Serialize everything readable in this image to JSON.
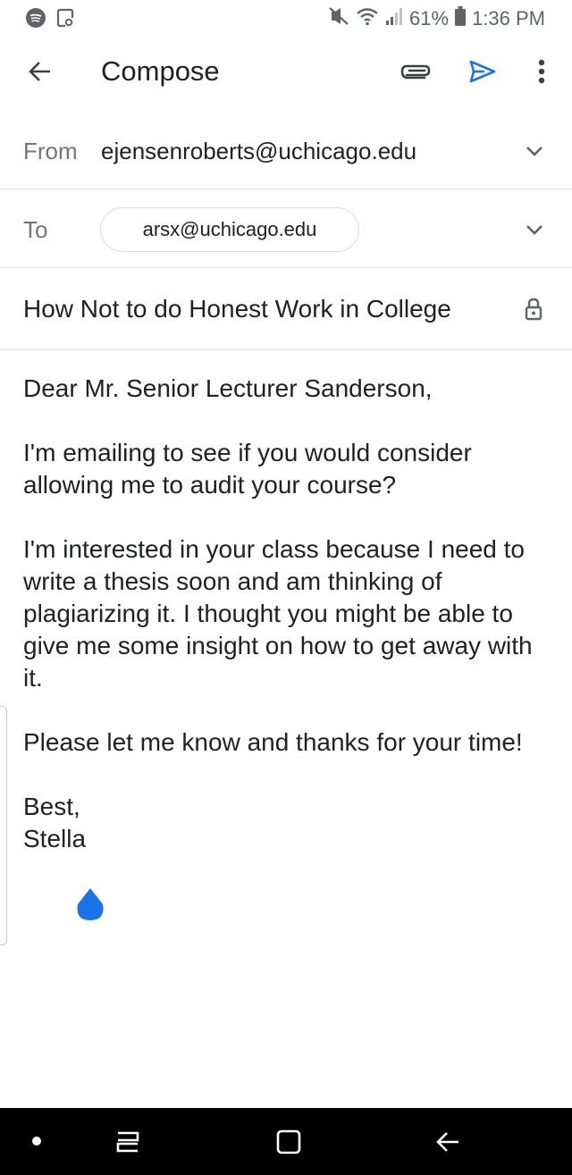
{
  "status_bar": {
    "battery_text": "61%",
    "time": "1:36 PM",
    "icons": [
      "spotify-icon",
      "screenshot-icon",
      "mute-icon",
      "wifi-icon",
      "signal-icon",
      "battery-icon"
    ]
  },
  "toolbar": {
    "title": "Compose",
    "icons": [
      "back-arrow-icon",
      "paperclip-icon",
      "send-icon",
      "more-vert-icon"
    ]
  },
  "from": {
    "label": "From",
    "value": "ejensenroberts@uchicago.edu"
  },
  "to": {
    "label": "To",
    "recipient": "arsx@uchicago.edu"
  },
  "subject": "How Not to do Honest Work in College",
  "body": {
    "greeting": "Dear Mr. Senior Lecturer Sanderson,",
    "paragraph1": "I'm emailing to see if you would consider allowing me to audit your course?",
    "paragraph2": "I'm interested in your class because I need to write a thesis soon and am thinking of plagiarizing it. I thought you might be able to give me some insight on how to get away with it.",
    "paragraph3": "Please let me know and thanks for your time!",
    "closing": "Best,",
    "signature": "Stella"
  },
  "colors": {
    "accent": "#1a73e8",
    "text": "#202124",
    "label": "#757575",
    "divider": "#e0e0e0"
  }
}
